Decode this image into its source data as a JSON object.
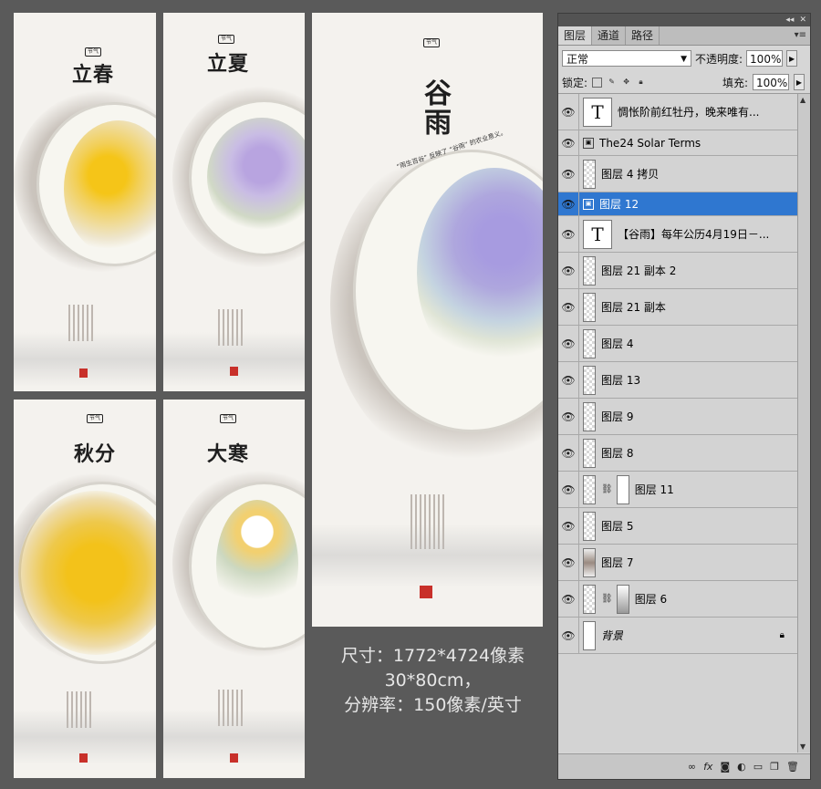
{
  "posters": {
    "lichun": {
      "title": "立春"
    },
    "lixia": {
      "title": "立夏"
    },
    "qiufen": {
      "title": "秋分"
    },
    "dahan": {
      "title": "大寒"
    },
    "guyu": {
      "title": "谷雨",
      "arc_text": "“雨生百谷” 反映了 “谷雨” 的农业意义。"
    }
  },
  "info": {
    "size": "尺寸：1772*4724像素",
    "cm": "30*80cm，",
    "resolution": "分辨率：150像素/英寸"
  },
  "panel": {
    "tabs": [
      "图层",
      "通道",
      "路径"
    ],
    "blend_mode": "正常",
    "opacity_label": "不透明度:",
    "opacity_value": "100%",
    "lock_label": "锁定:",
    "fill_label": "填充:",
    "fill_value": "100%",
    "layers": [
      {
        "name": "惆怅阶前红牡丹，晚来唯有...",
        "kind": "text"
      },
      {
        "name": "The24 Solar Terms",
        "kind": "smart"
      },
      {
        "name": "图层 4 拷贝",
        "kind": "pixel"
      },
      {
        "name": "图层 12",
        "kind": "smart",
        "selected": true
      },
      {
        "name": "【谷雨】每年公历4月19日－...",
        "kind": "text"
      },
      {
        "name": "图层 21 副本 2",
        "kind": "pixel"
      },
      {
        "name": "图层 21 副本",
        "kind": "pixel"
      },
      {
        "name": "图层 4",
        "kind": "pixel"
      },
      {
        "name": "图层 13",
        "kind": "pixel"
      },
      {
        "name": "图层 9",
        "kind": "pixel"
      },
      {
        "name": "图层 8",
        "kind": "pixel"
      },
      {
        "name": "图层 11",
        "kind": "mask"
      },
      {
        "name": "图层 5",
        "kind": "pixel"
      },
      {
        "name": "图层 7",
        "kind": "pixel"
      },
      {
        "name": "图层 6",
        "kind": "mask"
      },
      {
        "name": "背景",
        "kind": "background"
      }
    ],
    "bottom_icons": [
      "link-icon",
      "fx-icon",
      "mask-icon",
      "adjustment-icon",
      "group-icon",
      "new-layer-icon",
      "trash-icon"
    ]
  }
}
